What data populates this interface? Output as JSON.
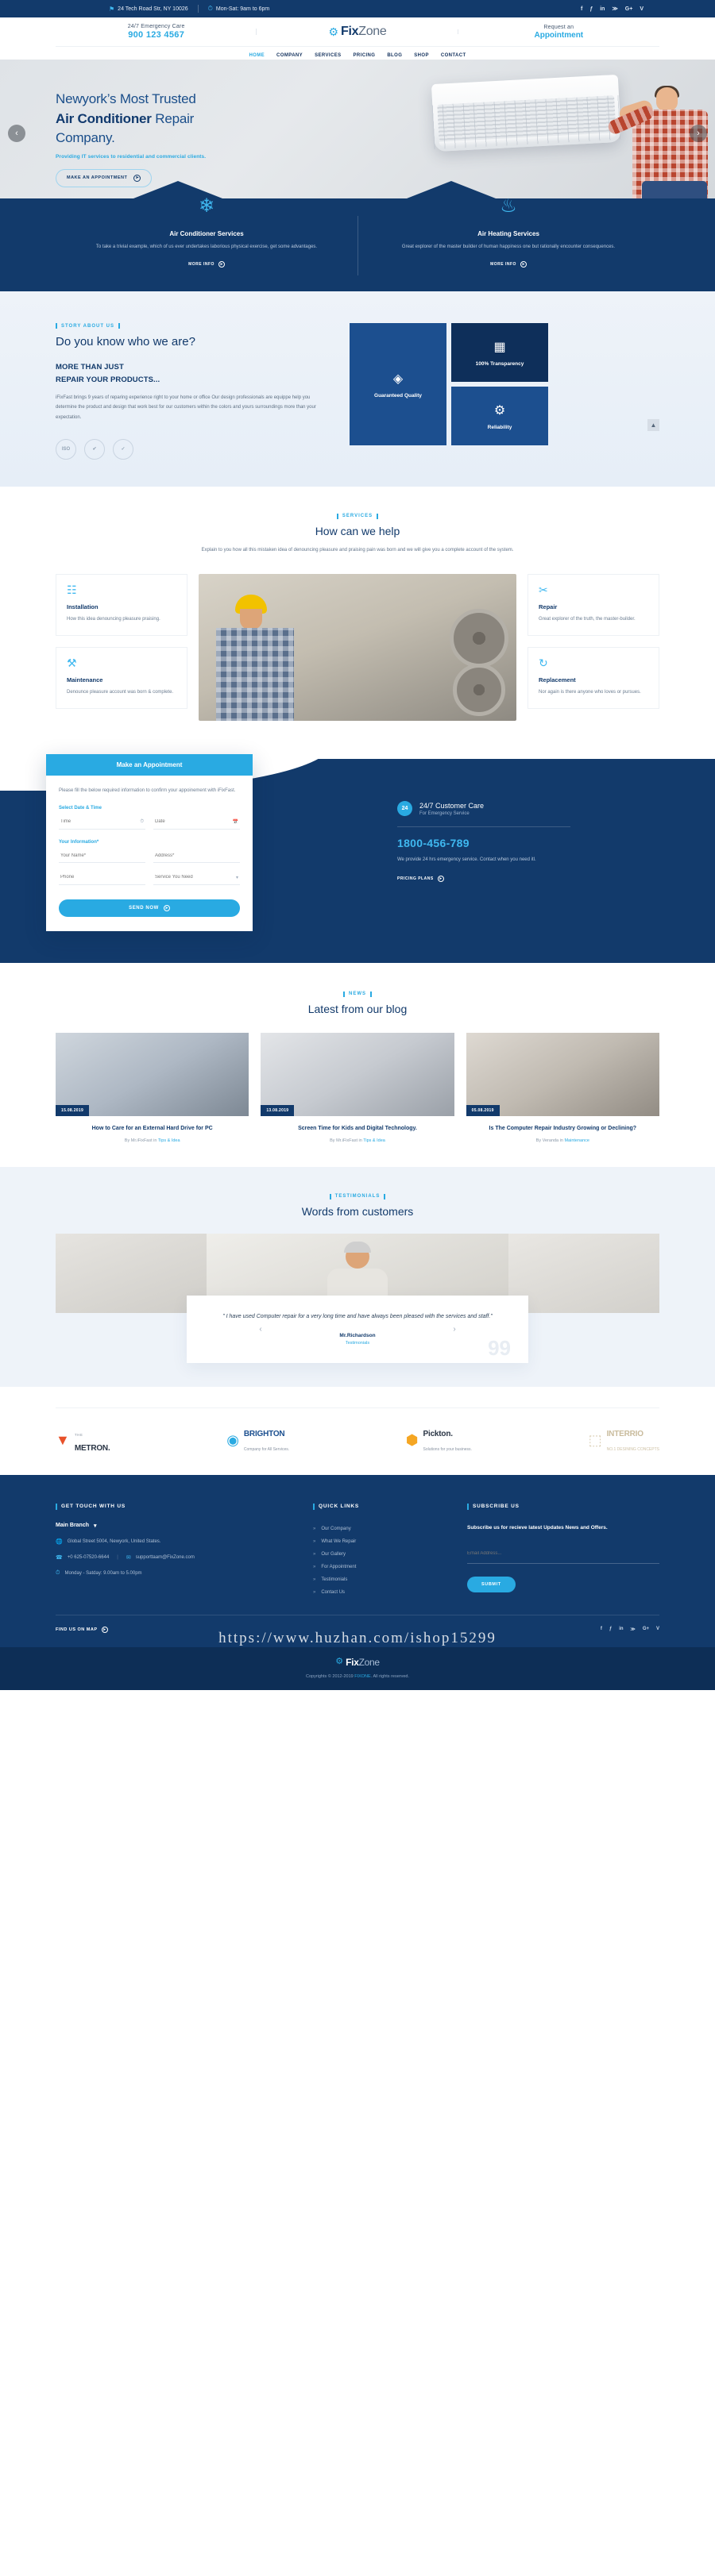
{
  "topbar": {
    "address": "24 Tech Road Str, NY 10026",
    "hours": "Mon-Sat: 9am to 6pm",
    "address_icon": "map-marker-icon",
    "hours_icon": "clock-icon",
    "social": [
      "f",
      "ƒ",
      "in",
      "≫",
      "G+",
      "V"
    ]
  },
  "header": {
    "emergency_label": "24/7 Emergency Care",
    "emergency_phone": "900 123 4567",
    "request_label": "Request an",
    "request_link": "Appointment",
    "brand_name": "Fix",
    "brand_name_light": "Zone",
    "nav": [
      {
        "label": "HOME",
        "active": true
      },
      {
        "label": "COMPANY",
        "active": false
      },
      {
        "label": "SERVICES",
        "active": false
      },
      {
        "label": "PRICING",
        "active": false
      },
      {
        "label": "BLOG",
        "active": false
      },
      {
        "label": "SHOP",
        "active": false
      },
      {
        "label": "CONTACT",
        "active": false
      }
    ]
  },
  "hero": {
    "line1": "Newyork’s Most Trusted",
    "line2_bold": "Air Conditioner",
    "line2_rest": " Repair",
    "line3": "Company.",
    "subtitle": "Providing IT services to residential and commercial clients.",
    "cta": "MAKE AN APPOINTMENT",
    "prev": "‹",
    "next": "›"
  },
  "service_band": [
    {
      "icon": "snowflake-icon",
      "glyph": "❄",
      "title": "Air Conditioner Services",
      "text": "To take a trivial example, which of us ever undertakes laborious physical exercise, get some advantages.",
      "more": "MORE INFO"
    },
    {
      "icon": "flame-icon",
      "glyph": "♨",
      "title": "Air Heating Services",
      "text": "Great explorer of the master builder of human happiness one but rationally encounter consequences.",
      "more": "MORE INFO"
    }
  ],
  "about": {
    "eyebrow": "STORY ABOUT US",
    "heading": "Do you know who we are?",
    "subheading_l1": "MORE THAN JUST",
    "subheading_l2": "REPAIR YOUR PRODUCTS...",
    "paragraph": "iFixFast brings 9 years of reparing experience right to your home or office Our design professionals are equippe help you determine the product and design that work best for our customers within the colors and yours surroundings more than your expectation.",
    "badges": [
      "ISO",
      "✔",
      "✓"
    ],
    "tiles": [
      {
        "label": "Guaranteed Quality",
        "icon": "diamond-badge-icon",
        "glyph": "◈"
      },
      {
        "label": "100% Transparency",
        "icon": "transparency-icon",
        "glyph": "▦"
      },
      {
        "label": "Reliability",
        "icon": "reliability-icon",
        "glyph": "⚙"
      }
    ],
    "scroll_top": "▲"
  },
  "help": {
    "eyebrow": "SERVICES",
    "heading": "How can we help",
    "paragraph": "Explain to you how all this mistaken idea of denouncing pleasure and praising pain was born and we will give you a complete account of the system.",
    "cards_left": [
      {
        "icon": "ac-unit-icon",
        "glyph": "☷",
        "title": "Installation",
        "text": "How this idea denouncing pleasure praising."
      },
      {
        "icon": "toolbox-icon",
        "glyph": "⚒",
        "title": "Maintenance",
        "text": "Denounce pleasure account was born & complete."
      }
    ],
    "cards_right": [
      {
        "icon": "scissors-tools-icon",
        "glyph": "✂",
        "title": "Repair",
        "text": "Great explorer of the truth, the master-builder."
      },
      {
        "icon": "replace-icon",
        "glyph": "↻",
        "title": "Replacement",
        "text": "Nor again is there anyone who loves or pursues."
      }
    ]
  },
  "appointment": {
    "title": "Make an Appointment",
    "description": "Please fill the below required information to confirm your appoinement with iFixFast.",
    "datetime_label": "Select Date & Time",
    "time_placeholder": "Time",
    "time_icon": "clock-icon",
    "date_placeholder": "Date",
    "date_icon": "calendar-icon",
    "info_label": "Your Information*",
    "name_placeholder": "Your Name*",
    "address_placeholder": "Address*",
    "phone_placeholder": "Phone",
    "service_placeholder": "Service You Need",
    "service_icon": "chevron-down-icon",
    "send_label": "SEND NOW",
    "care_title": "24/7 Customer Care",
    "care_subtitle": "For Emergency Service",
    "care_icon": "phone-24-icon",
    "care_number": "1800-456-789",
    "care_text": "We provide 24 hrs emergency service. Contact when you need itl.",
    "care_cta": "PRICING PLANS"
  },
  "blog": {
    "eyebrow": "NEWS",
    "heading": "Latest from our blog",
    "posts": [
      {
        "date": "15.08.2019",
        "title": "How to Care for an External Hard Drive for PC",
        "author": "Mr.iFixFast",
        "category": "Tips & Idea",
        "meta_prefix": "By ",
        "meta_in": " in "
      },
      {
        "date": "13.08.2019",
        "title": "Screen Time for Kids and Digital Technology.",
        "author": "Mr.iFixFast",
        "category": "Tips & Idea",
        "meta_prefix": "By ",
        "meta_in": " in "
      },
      {
        "date": "05.08.2019",
        "title": "Is The Computer Repair Industry Growing or Declining?",
        "author": "Veranda",
        "category": "Maintenance",
        "meta_prefix": "By ",
        "meta_in": " in "
      }
    ]
  },
  "testimonials": {
    "eyebrow": "TESTIMONIALS",
    "heading": "Words from customers",
    "quote": "\" I have used Computer repair for a very long time and have always been pleased with the services and staff.\"",
    "name": "Mr.Richardson",
    "role": "Testimonials",
    "quote_mark": "99",
    "prev": "‹",
    "next": "›"
  },
  "partners": [
    {
      "mark": "▼",
      "mark_color": "#e8522a",
      "small": "THE",
      "big": "METRON.",
      "tag": ""
    },
    {
      "mark": "◉",
      "mark_color": "#29aae2",
      "small": "",
      "big": "BRIGHTON",
      "tag": "Company for All Services."
    },
    {
      "mark": "⬢",
      "mark_color": "#f5a623",
      "small": "",
      "big": "Pickton.",
      "tag": "Solutions for your business."
    },
    {
      "mark": "⬚",
      "mark_color": "#d8cbb0",
      "small": "",
      "big": "INTERRIO",
      "tag": "NO.1 DESINING CONCEPTS"
    }
  ],
  "footer": {
    "col1_head": "GET TOUCH WITH US",
    "branch": "Main Branch",
    "branch_icon": "chevron-down-icon",
    "address": "Global Street 5004, Newyork, United States.",
    "address_icon": "globe-icon",
    "phone": "+0 625-07520-6644",
    "phone_icon": "phone-icon",
    "email": "supporttaam@FixZone.com",
    "email_icon": "envelope-icon",
    "hours": "Monday - Satday: 9.00am to 5.00pm",
    "hours_icon": "clock-icon",
    "map_label": "FIND US ON MAP",
    "col2_head": "QUICK LINKS",
    "quick_links": [
      "Our Company",
      "What We Repair",
      "Our Gallery",
      "For Appointment",
      "Testimonials",
      "Contact Us"
    ],
    "col3_head": "SUBSCRIBE US",
    "subscribe_text": "Subscribe us for recieve latest Updates News and Offers.",
    "email_placeholder": "Email Address...",
    "submit_label": "SUBMIT",
    "social": [
      "f",
      "ƒ",
      "in",
      "≫",
      "G+",
      "V"
    ],
    "watermark": "https://www.huzhan.com/ishop15299",
    "brand_name": "Fix",
    "brand_name_light": "Zone",
    "copyright": "Copyrights © 2012-2019 ",
    "copyright_brand": "FIXONE",
    "copyright_tail": ". All rights reserved."
  }
}
